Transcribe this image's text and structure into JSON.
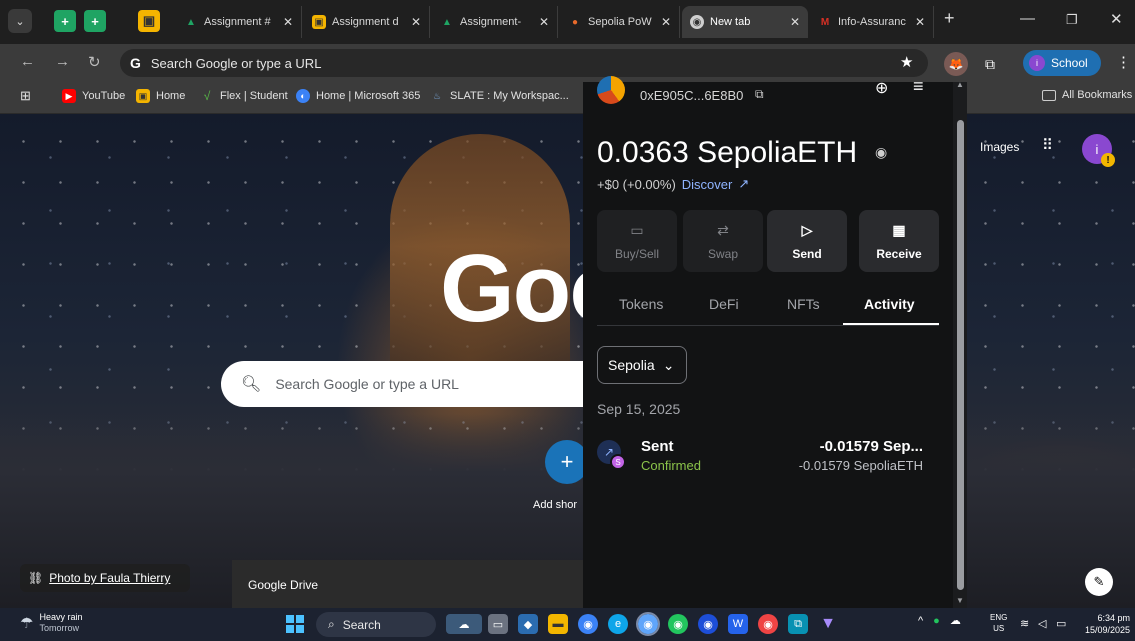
{
  "browser": {
    "tabs": [
      {
        "label": "Assignment #",
        "icon": "drive-icon",
        "color": "#1fa463"
      },
      {
        "label": "Assignment d",
        "icon": "classroom-icon",
        "color": "#f4b400"
      },
      {
        "label": "Assignment-",
        "icon": "drive-icon",
        "color": "#1fa463"
      },
      {
        "label": "Sepolia PoW",
        "icon": "faucet-icon",
        "color": "#e86a2b"
      },
      {
        "label": "New tab",
        "icon": "chrome-icon",
        "color": "#cfcfcf",
        "active": true
      },
      {
        "label": "Info-Assuranc",
        "icon": "gmail-icon",
        "color": "#d93025"
      }
    ],
    "close_glyph": "✕",
    "new_tab_glyph": "+",
    "omnibox": {
      "text": "Search Google or type a URL",
      "logo": "G"
    },
    "profile_label": "School",
    "profile_initial": "i",
    "bookmarks": [
      {
        "label": "YouTube",
        "icon": "youtube-icon",
        "color": "#ff0000"
      },
      {
        "label": "Home",
        "icon": "classroom-icon",
        "color": "#f4b400"
      },
      {
        "label": "Flex | Student",
        "icon": "flex-icon",
        "color": "#58b947"
      },
      {
        "label": "Home | Microsoft 365",
        "icon": "m365-icon",
        "color": "#3b82f6"
      },
      {
        "label": "SLATE : My Workspac...",
        "icon": "slate-icon",
        "color": "#7aa6d6"
      }
    ],
    "all_bookmarks": "All Bookmarks"
  },
  "ntp": {
    "google_word": "Goo",
    "search_placeholder": "Search Google or type a URL",
    "add_shortcut": "Add shor",
    "images_link": "Images",
    "avatar_initial": "i",
    "photo_credit": "Photo by Faula Thierry",
    "drive_card": "Google Drive"
  },
  "wallet": {
    "address": "0xE905C...6E8B0",
    "balance": "0.0363 SepoliaETH",
    "change": "+$0 (+0.00%)",
    "discover": "Discover",
    "actions": [
      {
        "label": "Buy/Sell",
        "icon": "card-icon",
        "enabled": false
      },
      {
        "label": "Swap",
        "icon": "swap-icon",
        "enabled": false
      },
      {
        "label": "Send",
        "icon": "send-icon",
        "enabled": true
      },
      {
        "label": "Receive",
        "icon": "qr-icon",
        "enabled": true
      }
    ],
    "tabs": [
      "Tokens",
      "DeFi",
      "NFTs",
      "Activity"
    ],
    "active_tab": "Activity",
    "network": "Sepolia",
    "date": "Sep 15, 2025",
    "transaction": {
      "title": "Sent",
      "status": "Confirmed",
      "amount": "-0.01579 Sep...",
      "amount_full": "-0.01579 SepoliaETH",
      "badge": "S"
    }
  },
  "taskbar": {
    "weather_title": "Heavy rain",
    "weather_sub": "Tomorrow",
    "search_label": "Search",
    "lang_1": "ENG",
    "lang_2": "US",
    "time": "6:34 pm",
    "date": "15/09/2025"
  }
}
